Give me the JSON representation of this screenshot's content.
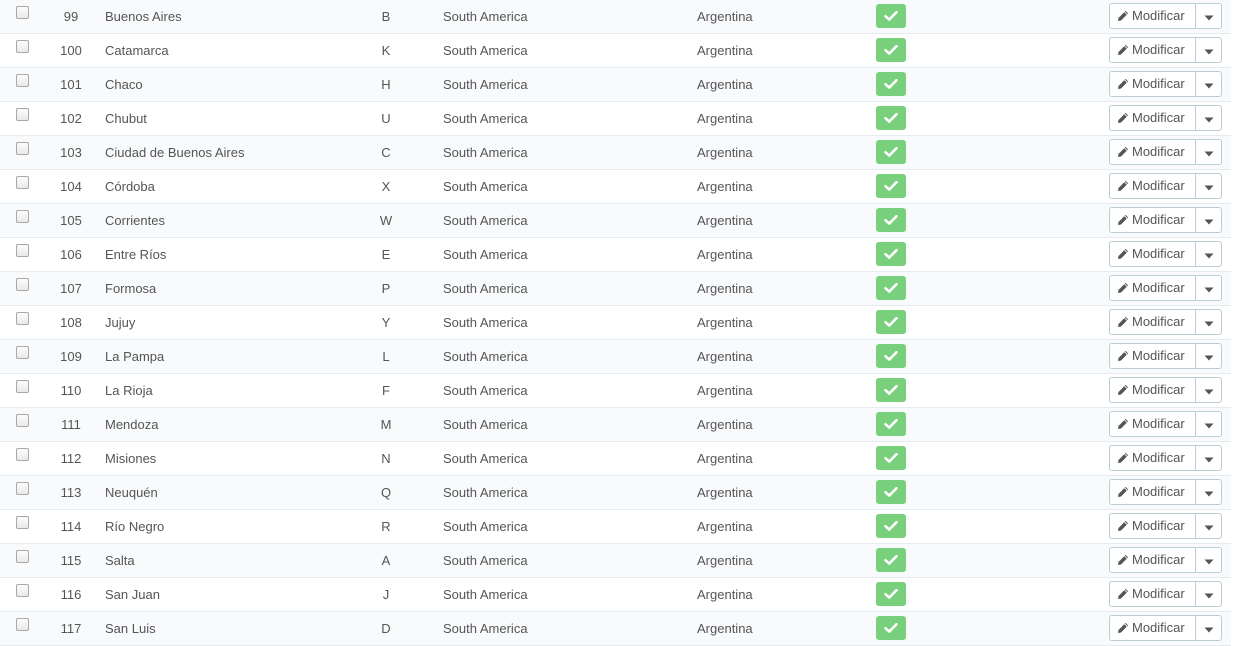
{
  "table": {
    "rows": [
      {
        "id": "99",
        "name": "Buenos Aires",
        "iso": "B",
        "zone": "South America",
        "country": "Argentina",
        "enabled": true
      },
      {
        "id": "100",
        "name": "Catamarca",
        "iso": "K",
        "zone": "South America",
        "country": "Argentina",
        "enabled": true
      },
      {
        "id": "101",
        "name": "Chaco",
        "iso": "H",
        "zone": "South America",
        "country": "Argentina",
        "enabled": true
      },
      {
        "id": "102",
        "name": "Chubut",
        "iso": "U",
        "zone": "South America",
        "country": "Argentina",
        "enabled": true
      },
      {
        "id": "103",
        "name": "Ciudad de Buenos Aires",
        "iso": "C",
        "zone": "South America",
        "country": "Argentina",
        "enabled": true
      },
      {
        "id": "104",
        "name": "Córdoba",
        "iso": "X",
        "zone": "South America",
        "country": "Argentina",
        "enabled": true
      },
      {
        "id": "105",
        "name": "Corrientes",
        "iso": "W",
        "zone": "South America",
        "country": "Argentina",
        "enabled": true
      },
      {
        "id": "106",
        "name": "Entre Ríos",
        "iso": "E",
        "zone": "South America",
        "country": "Argentina",
        "enabled": true
      },
      {
        "id": "107",
        "name": "Formosa",
        "iso": "P",
        "zone": "South America",
        "country": "Argentina",
        "enabled": true
      },
      {
        "id": "108",
        "name": "Jujuy",
        "iso": "Y",
        "zone": "South America",
        "country": "Argentina",
        "enabled": true
      },
      {
        "id": "109",
        "name": "La Pampa",
        "iso": "L",
        "zone": "South America",
        "country": "Argentina",
        "enabled": true
      },
      {
        "id": "110",
        "name": "La Rioja",
        "iso": "F",
        "zone": "South America",
        "country": "Argentina",
        "enabled": true
      },
      {
        "id": "111",
        "name": "Mendoza",
        "iso": "M",
        "zone": "South America",
        "country": "Argentina",
        "enabled": true
      },
      {
        "id": "112",
        "name": "Misiones",
        "iso": "N",
        "zone": "South America",
        "country": "Argentina",
        "enabled": true
      },
      {
        "id": "113",
        "name": "Neuquén",
        "iso": "Q",
        "zone": "South America",
        "country": "Argentina",
        "enabled": true
      },
      {
        "id": "114",
        "name": "Río Negro",
        "iso": "R",
        "zone": "South America",
        "country": "Argentina",
        "enabled": true
      },
      {
        "id": "115",
        "name": "Salta",
        "iso": "A",
        "zone": "South America",
        "country": "Argentina",
        "enabled": true
      },
      {
        "id": "116",
        "name": "San Juan",
        "iso": "J",
        "zone": "South America",
        "country": "Argentina",
        "enabled": true
      },
      {
        "id": "117",
        "name": "San Luis",
        "iso": "D",
        "zone": "South America",
        "country": "Argentina",
        "enabled": true
      }
    ],
    "edit_label": "Modificar"
  },
  "icons": {
    "edit": "pencil-icon",
    "status": "check-icon",
    "menu": "caret-down-icon"
  },
  "colors": {
    "status_enabled": "#78d07d",
    "row_border": "#e6ebef",
    "button_border": "#bbcdd2",
    "text": "#555555"
  }
}
